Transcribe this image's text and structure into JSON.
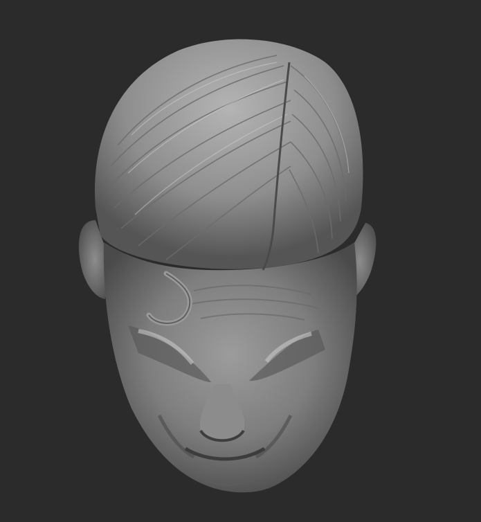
{
  "viewport": {
    "background": "#2b2b2b",
    "subject": "sculpted-head",
    "material_color": "#8a8a8a"
  }
}
